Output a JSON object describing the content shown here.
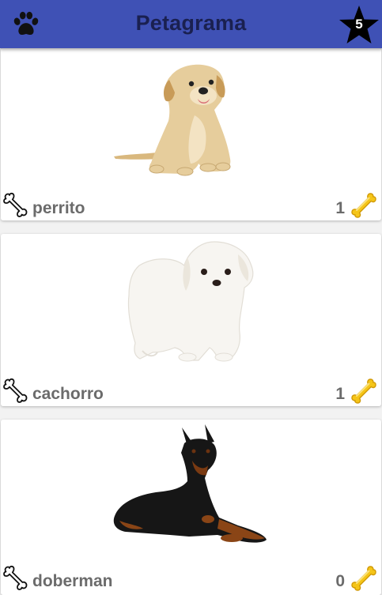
{
  "app_bar": {
    "title": "Petagrama",
    "favorites_count": "5",
    "paw_icon": "paw-icon",
    "star_icon": "star-icon"
  },
  "colors": {
    "primary": "#3f51b5",
    "title_text": "#1a2050",
    "card_text": "#6b6b6b",
    "gold_bone": "#f5c518"
  },
  "pets": [
    {
      "name": "perrito",
      "likes": "1"
    },
    {
      "name": "cachorro",
      "likes": "1"
    },
    {
      "name": "doberman",
      "likes": "0"
    }
  ]
}
